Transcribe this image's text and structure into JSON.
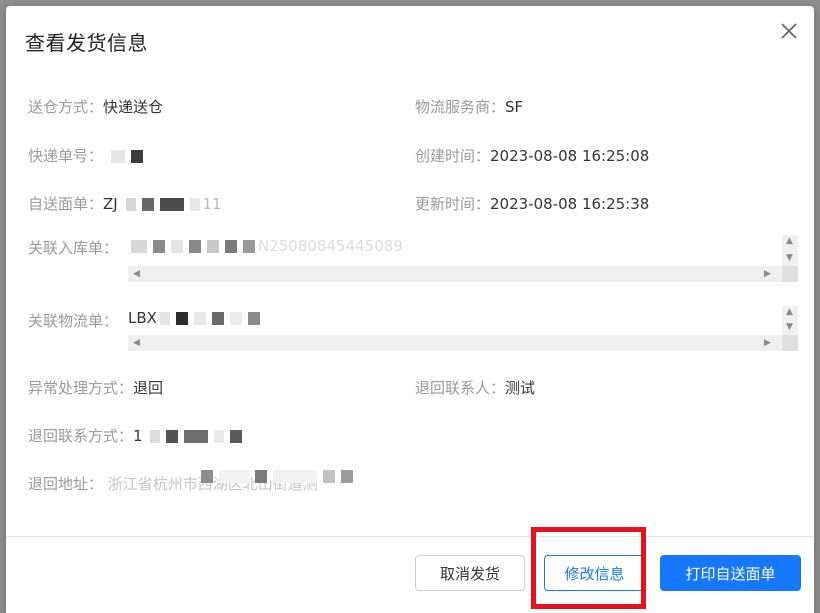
{
  "dialog": {
    "title": "查看发货信息",
    "close_icon": "close-icon"
  },
  "fields": {
    "delivery_method": {
      "label": "送仓方式：",
      "value": "快递送仓"
    },
    "logistics_provider": {
      "label": "物流服务商：",
      "value": "SF"
    },
    "tracking_no": {
      "label": "快递单号：",
      "value": ""
    },
    "created_time": {
      "label": "创建时间：",
      "value": "2023-08-08 16:25:08"
    },
    "self_waybill": {
      "label": "自送面单：",
      "value_prefix": "ZJ",
      "value_suffix": "11"
    },
    "updated_time": {
      "label": "更新时间：",
      "value": "2023-08-08 16:25:38"
    },
    "linked_inbound": {
      "label": "关联入库单：",
      "value_visible": "N25080845445089"
    },
    "linked_logistics": {
      "label": "关联物流单：",
      "value_prefix": "LBX"
    },
    "exception_method": {
      "label": "异常处理方式：",
      "value": "退回"
    },
    "return_contact": {
      "label": "退回联系人：",
      "value": "测试"
    },
    "return_phone": {
      "label": "退回联系方式：",
      "value_prefix": "1"
    },
    "return_address": {
      "label": "退回地址：",
      "value_visible": "浙江省杭州市西湖区北山街道测"
    }
  },
  "footer": {
    "cancel_label": "取消发货",
    "edit_label": "修改信息",
    "print_label": "打印自送面单"
  },
  "colors": {
    "primary": "#1677ff",
    "highlight": "#e8101a",
    "label": "#9a9a9a"
  }
}
